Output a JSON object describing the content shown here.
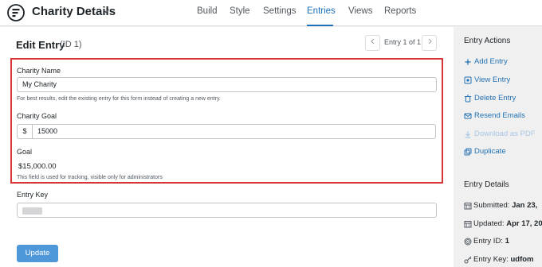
{
  "app": {
    "form_title": "Charity Details",
    "nav": [
      "Build",
      "Style",
      "Settings",
      "Entries",
      "Views",
      "Reports"
    ],
    "active_tab": "Entries"
  },
  "main": {
    "heading": "Edit Entry",
    "entry_id": "(ID 1)",
    "pager_label": "Entry 1 of 1",
    "fields": {
      "charity_name": {
        "label": "Charity Name",
        "value": "My Charity",
        "hint": "For best results, edit the existing entry for this form instead of creating a new entry."
      },
      "charity_goal": {
        "label": "Charity Goal",
        "prefix": "$",
        "value": "15000"
      },
      "goal": {
        "label": "Goal",
        "value": "$15,000.00",
        "hint": "This field is used for tracking, visible only for administrators"
      },
      "entry_key": {
        "label": "Entry Key"
      }
    },
    "update_label": "Update"
  },
  "sidebar": {
    "actions_heading": "Entry Actions",
    "actions": [
      {
        "label": "Add Entry",
        "icon": "plus-icon"
      },
      {
        "label": "View Entry",
        "icon": "view-icon"
      },
      {
        "label": "Delete Entry",
        "icon": "trash-icon"
      },
      {
        "label": "Resend Emails",
        "icon": "mail-icon"
      },
      {
        "label": "Download as PDF",
        "icon": "download-icon"
      },
      {
        "label": "Duplicate",
        "icon": "duplicate-icon"
      }
    ],
    "details_heading": "Entry Details",
    "details": {
      "submitted_label": "Submitted:",
      "submitted_value": "Jan 23,",
      "updated_label": "Updated:",
      "updated_value": "Apr 17, 20",
      "entry_id_label": "Entry ID:",
      "entry_id_value": "1",
      "entry_key_label": "Entry Key:",
      "entry_key_value": "udfom"
    }
  },
  "colors": {
    "accent": "#2271b1",
    "highlight_border": "#d63638",
    "update_button": "#4e97d8"
  }
}
